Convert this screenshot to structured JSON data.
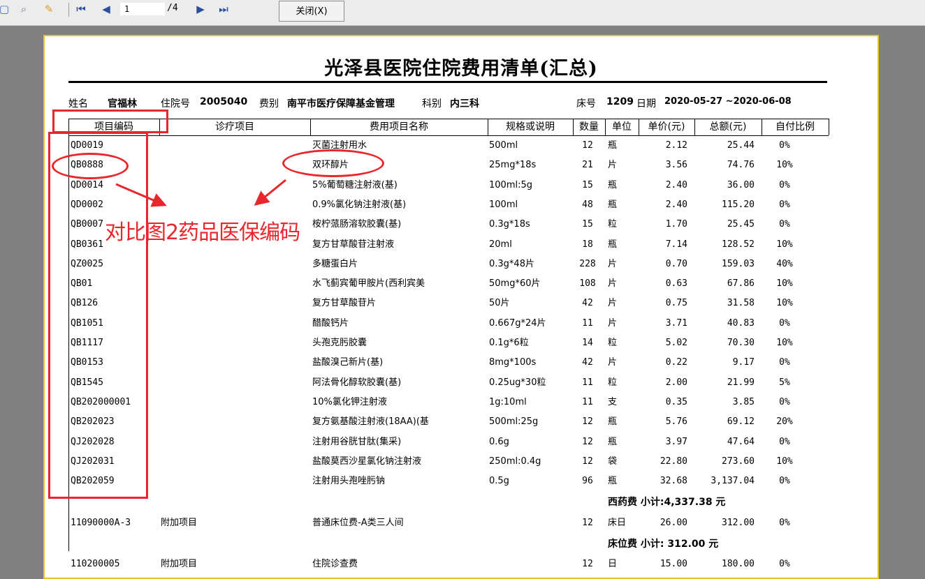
{
  "toolbar": {
    "page_current": "1",
    "page_total": "/4",
    "close_label": "关闭(X)"
  },
  "document": {
    "title": "光泽县医院住院费用清单(汇总)",
    "info": {
      "name_label": "姓名",
      "name_value": "官福林",
      "admission_label": "住院号",
      "admission_value": "2005040",
      "fee_type_label": "费别",
      "fee_type_value": "南平市医疗保障基金管理",
      "dept_label": "科别",
      "dept_value": "内三科",
      "bed_label": "床号",
      "bed_value": "1209",
      "date_label": "日期",
      "date_value": "2020-05-27 ~2020-06-08"
    },
    "columns": [
      "项目编码",
      "诊疗项目",
      "费用项目名称",
      "规格或说明",
      "数量",
      "单位",
      "单价(元)",
      "总额(元)",
      "自付比例"
    ],
    "rows": [
      {
        "code": "QD0019",
        "item": "",
        "name": "灭菌注射用水",
        "spec": "500ml",
        "qty": "12",
        "unit": "瓶",
        "price": "2.12",
        "total": "25.44",
        "ratio": "0%"
      },
      {
        "code": "QB0888",
        "item": "",
        "name": "双环醇片",
        "spec": "25mg*18s",
        "qty": "21",
        "unit": "片",
        "price": "3.56",
        "total": "74.76",
        "ratio": "10%"
      },
      {
        "code": "QD0014",
        "item": "",
        "name": "5%葡萄糖注射液(基)",
        "spec": "100ml:5g",
        "qty": "15",
        "unit": "瓶",
        "price": "2.40",
        "total": "36.00",
        "ratio": "0%"
      },
      {
        "code": "QD0002",
        "item": "",
        "name": "0.9%氯化钠注射液(基)",
        "spec": "100ml",
        "qty": "48",
        "unit": "瓶",
        "price": "2.40",
        "total": "115.20",
        "ratio": "0%"
      },
      {
        "code": "QB0007",
        "item": "",
        "name": "桉柠蒎肠溶软胶囊(基)",
        "spec": "0.3g*18s",
        "qty": "15",
        "unit": "粒",
        "price": "1.70",
        "total": "25.45",
        "ratio": "0%"
      },
      {
        "code": "QB0361",
        "item": "",
        "name": "复方甘草酸苷注射液",
        "spec": "20ml",
        "qty": "18",
        "unit": "瓶",
        "price": "7.14",
        "total": "128.52",
        "ratio": "10%"
      },
      {
        "code": "QZ0025",
        "item": "",
        "name": "多糖蛋白片",
        "spec": "0.3g*48片",
        "qty": "228",
        "unit": "片",
        "price": "0.70",
        "total": "159.03",
        "ratio": "40%"
      },
      {
        "code": "QB01",
        "item": "",
        "name": "水飞蓟宾葡甲胺片(西利宾美",
        "spec": "50mg*60片",
        "qty": "108",
        "unit": "片",
        "price": "0.63",
        "total": "67.86",
        "ratio": "10%"
      },
      {
        "code": "QB126",
        "item": "",
        "name": "复方甘草酸苷片",
        "spec": "50片",
        "qty": "42",
        "unit": "片",
        "price": "0.75",
        "total": "31.58",
        "ratio": "10%"
      },
      {
        "code": "QB1051",
        "item": "",
        "name": "醋酸钙片",
        "spec": "0.667g*24片",
        "qty": "11",
        "unit": "片",
        "price": "3.71",
        "total": "40.83",
        "ratio": "0%"
      },
      {
        "code": "QB1117",
        "item": "",
        "name": "头孢克肟胶囊",
        "spec": "0.1g*6粒",
        "qty": "14",
        "unit": "粒",
        "price": "5.02",
        "total": "70.30",
        "ratio": "10%"
      },
      {
        "code": "QB0153",
        "item": "",
        "name": "盐酸溴己新片(基)",
        "spec": "8mg*100s",
        "qty": "42",
        "unit": "片",
        "price": "0.22",
        "total": "9.17",
        "ratio": "0%"
      },
      {
        "code": "QB1545",
        "item": "",
        "name": "阿法骨化醇软胶囊(基)",
        "spec": "0.25ug*30粒",
        "qty": "11",
        "unit": "粒",
        "price": "2.00",
        "total": "21.99",
        "ratio": "5%"
      },
      {
        "code": "QB202000001",
        "item": "",
        "name": "10%氯化钾注射液",
        "spec": "1g:10ml",
        "qty": "11",
        "unit": "支",
        "price": "0.35",
        "total": "3.85",
        "ratio": "0%"
      },
      {
        "code": "QB202023",
        "item": "",
        "name": "复方氨基酸注射液(18AA)(基",
        "spec": "500ml:25g",
        "qty": "12",
        "unit": "瓶",
        "price": "5.76",
        "total": "69.12",
        "ratio": "20%"
      },
      {
        "code": "QJ202028",
        "item": "",
        "name": "注射用谷胱甘肽(集采)",
        "spec": "0.6g",
        "qty": "12",
        "unit": "瓶",
        "price": "3.97",
        "total": "47.64",
        "ratio": "0%"
      },
      {
        "code": "QJ202031",
        "item": "",
        "name": "盐酸莫西沙星氯化钠注射液",
        "spec": "250ml:0.4g",
        "qty": "12",
        "unit": "袋",
        "price": "22.80",
        "total": "273.60",
        "ratio": "10%"
      },
      {
        "code": "QB202059",
        "item": "",
        "name": "注射用头孢唑肟钠",
        "spec": "0.5g",
        "qty": "96",
        "unit": "瓶",
        "price": "32.68",
        "total": "3,137.04",
        "ratio": "0%"
      }
    ],
    "subtotal_drugs": "西药费 小计:4,337.38 元",
    "bed_rows": [
      {
        "code": "11090000A-3",
        "item": "附加项目",
        "name": "普通床位费-A类三人间",
        "spec": "",
        "qty": "12",
        "unit": "床日",
        "price": "26.00",
        "total": "312.00",
        "ratio": "0%"
      }
    ],
    "subtotal_bed": "床位费 小计: 312.00 元",
    "exam_rows": [
      {
        "code": "110200005",
        "item": "附加项目",
        "name": "住院诊查费",
        "spec": "",
        "qty": "12",
        "unit": "日",
        "price": "15.00",
        "total": "180.00",
        "ratio": "0%"
      }
    ]
  },
  "annotation": {
    "text": "对比图2药品医保编码",
    "color": "#e8262b"
  }
}
